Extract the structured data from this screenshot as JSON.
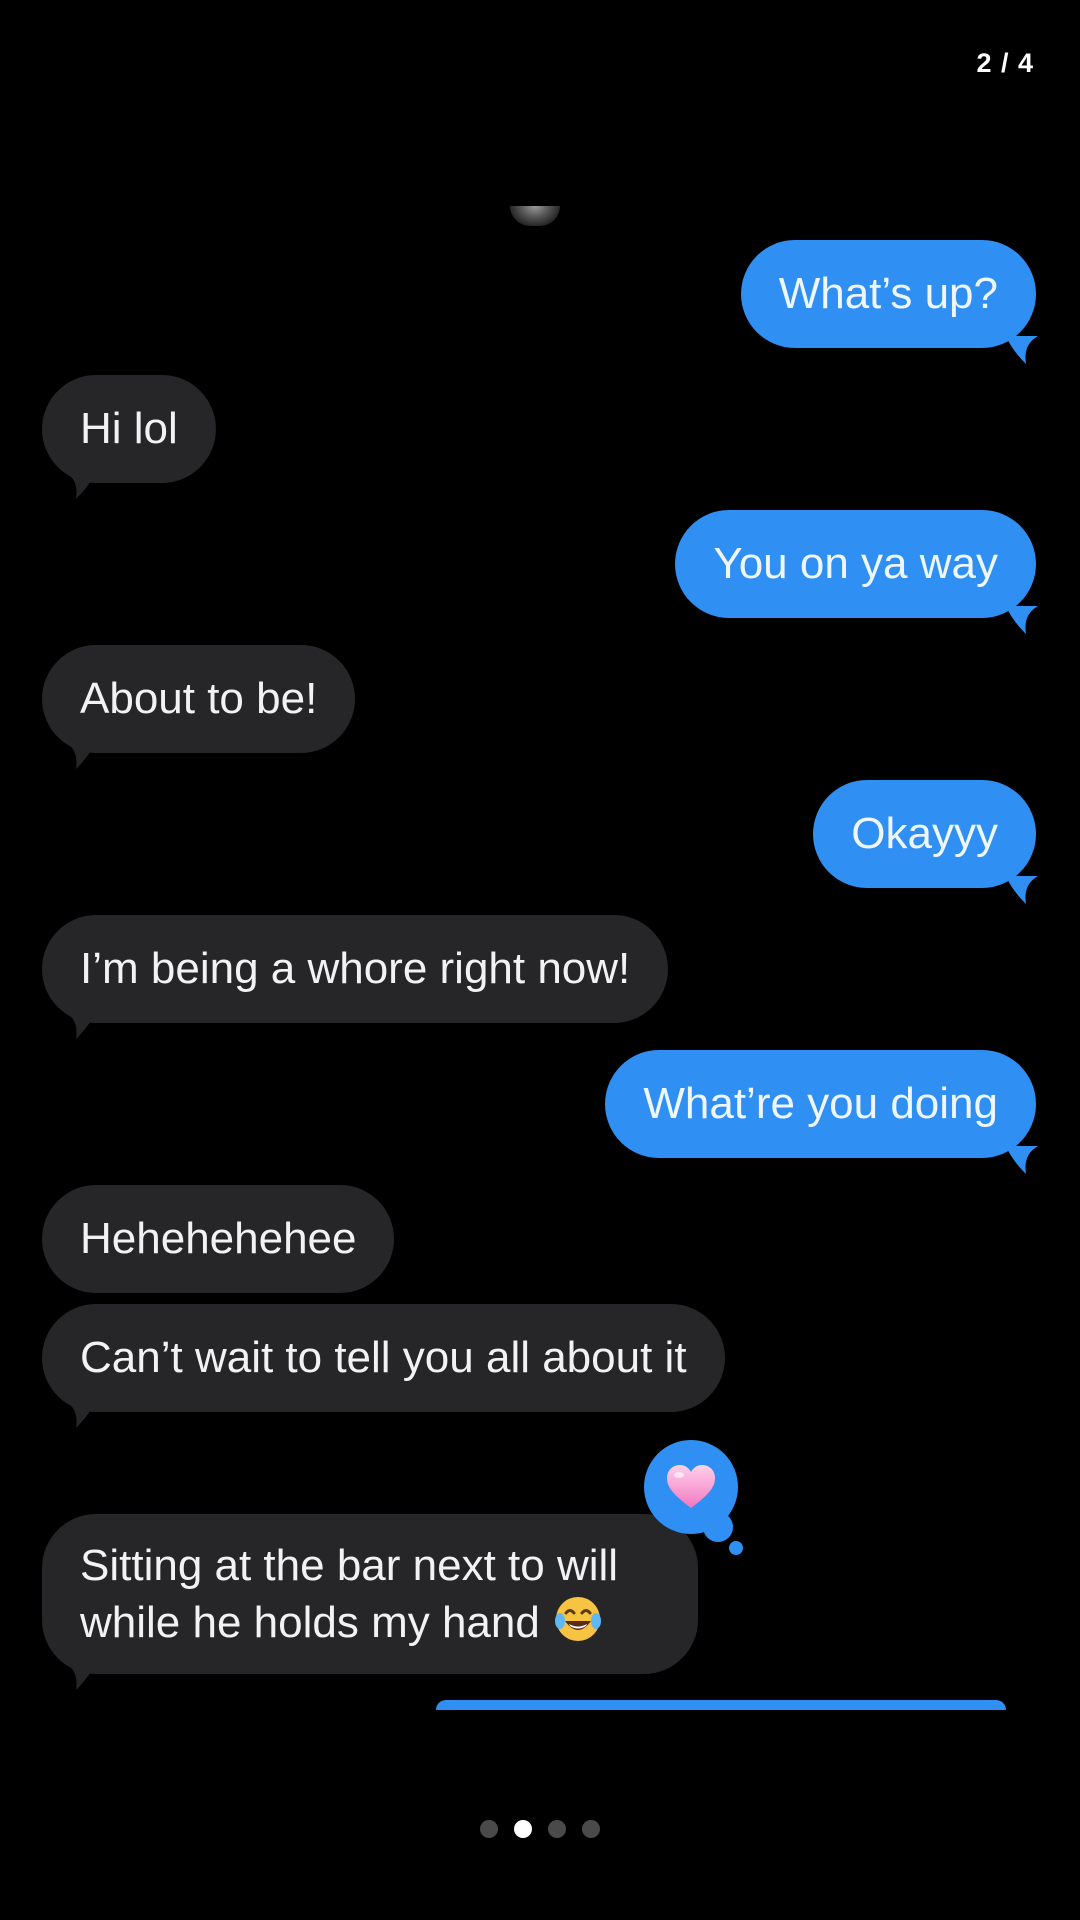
{
  "page_counter": "2 / 4",
  "colors": {
    "background": "#000000",
    "sent_bubble": "#2f8ff3",
    "received_bubble": "#262628"
  },
  "messages": [
    {
      "side": "sent",
      "text": "What’s up?"
    },
    {
      "side": "received",
      "text": "Hi lol"
    },
    {
      "side": "sent",
      "text": "You on ya way"
    },
    {
      "side": "received",
      "text": "About to be!"
    },
    {
      "side": "sent",
      "text": "Okayyy"
    },
    {
      "side": "received",
      "text": "I’m being a whore right now!"
    },
    {
      "side": "sent",
      "text": "What’re you doing"
    },
    {
      "side": "received",
      "text": "Hehehehehee"
    },
    {
      "side": "received",
      "text": "Can’t wait to tell you all about it"
    },
    {
      "side": "received",
      "text": "Sitting at the bar next to will while he holds my hand",
      "emoji": "face-with-tears-of-joy",
      "reaction": "pink-heart"
    }
  ],
  "pagination": {
    "total": 4,
    "active_index": 1
  }
}
